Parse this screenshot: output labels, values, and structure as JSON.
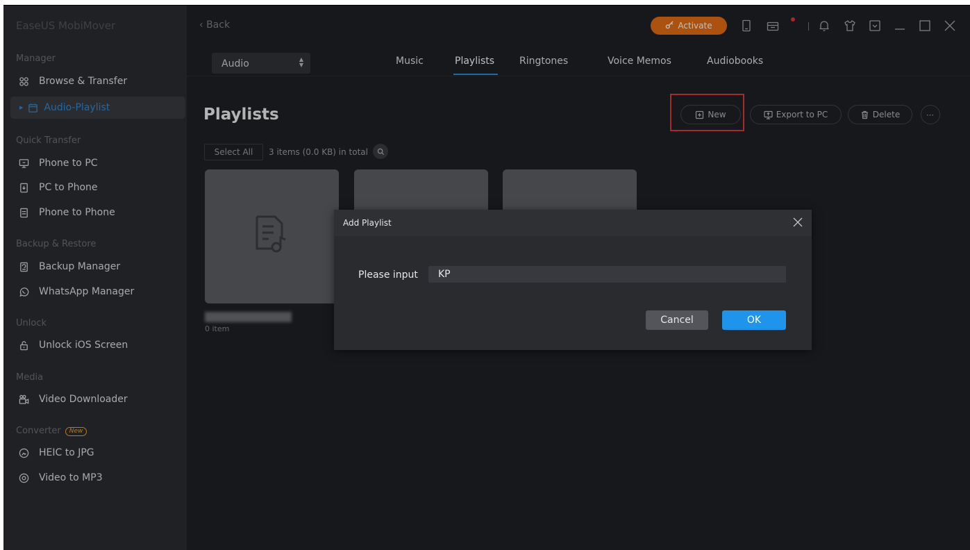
{
  "app": {
    "name": "EaseUS MobiMover"
  },
  "topbar": {
    "back_label": "Back",
    "activate_label": "Activate"
  },
  "sidebar": {
    "sections": [
      {
        "label": "Manager",
        "items": [
          {
            "label": "Browse & Transfer",
            "icon": "grid-icon"
          },
          {
            "label": "Audio-Playlist",
            "icon": "playlist-icon",
            "active": true
          }
        ]
      },
      {
        "label": "Quick Transfer",
        "items": [
          {
            "label": "Phone to PC",
            "icon": "phone-to-pc-icon"
          },
          {
            "label": "PC to Phone",
            "icon": "pc-to-phone-icon"
          },
          {
            "label": "Phone to Phone",
            "icon": "phone-to-phone-icon"
          }
        ]
      },
      {
        "label": "Backup & Restore",
        "items": [
          {
            "label": "Backup Manager",
            "icon": "backup-icon"
          },
          {
            "label": "WhatsApp Manager",
            "icon": "whatsapp-icon"
          }
        ]
      },
      {
        "label": "Unlock",
        "items": [
          {
            "label": "Unlock iOS Screen",
            "icon": "unlock-icon"
          }
        ]
      },
      {
        "label": "Media",
        "items": [
          {
            "label": "Video Downloader",
            "icon": "video-download-icon"
          }
        ]
      },
      {
        "label": "Converter",
        "badge": "New",
        "items": [
          {
            "label": "HEIC to JPG",
            "icon": "heic-icon"
          },
          {
            "label": "Video to MP3",
            "icon": "mp3-icon"
          }
        ]
      }
    ]
  },
  "category_select": {
    "value": "Audio"
  },
  "tabs": [
    {
      "label": "Music"
    },
    {
      "label": "Playlists",
      "active": true
    },
    {
      "label": "Ringtones"
    },
    {
      "label": "Voice Memos"
    },
    {
      "label": "Audiobooks"
    }
  ],
  "page": {
    "title": "Playlists",
    "actions": {
      "new": "New",
      "export": "Export to PC",
      "delete": "Delete"
    },
    "select_all": "Select All",
    "count_text": "3 items (0.0 KB) in total",
    "first_card_count": "0 item"
  },
  "dialog": {
    "title": "Add Playlist",
    "label": "Please input",
    "input_value": "KP",
    "cancel_label": "Cancel",
    "ok_label": "OK"
  },
  "colors": {
    "accent": "#2f8bd8",
    "activate": "#e46e16",
    "highlight": "#e1383c",
    "ok": "#1e94ea"
  }
}
